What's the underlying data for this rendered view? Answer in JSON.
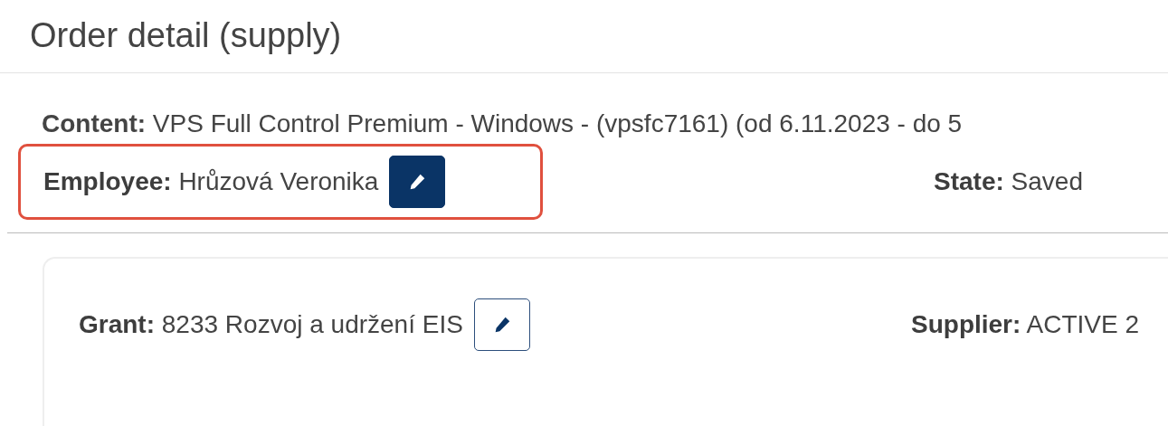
{
  "title": "Order detail (supply)",
  "header": {
    "content": {
      "label": "Content:",
      "value": "VPS Full Control Premium - Windows - (vpsfc7161) (od 6.11.2023 - do 5"
    },
    "employee": {
      "label": "Employee:",
      "value": "Hrůzová Veronika",
      "highlighted": true,
      "edit_button": {
        "kind": "filled"
      }
    },
    "state": {
      "label": "State:",
      "value": "Saved"
    }
  },
  "card": {
    "grant": {
      "label": "Grant:",
      "value": "8233 Rozvoj a udržení EIS",
      "edit_button": {
        "kind": "outline"
      }
    },
    "supplier": {
      "label": "Supplier:",
      "value": "ACTIVE 2"
    }
  }
}
